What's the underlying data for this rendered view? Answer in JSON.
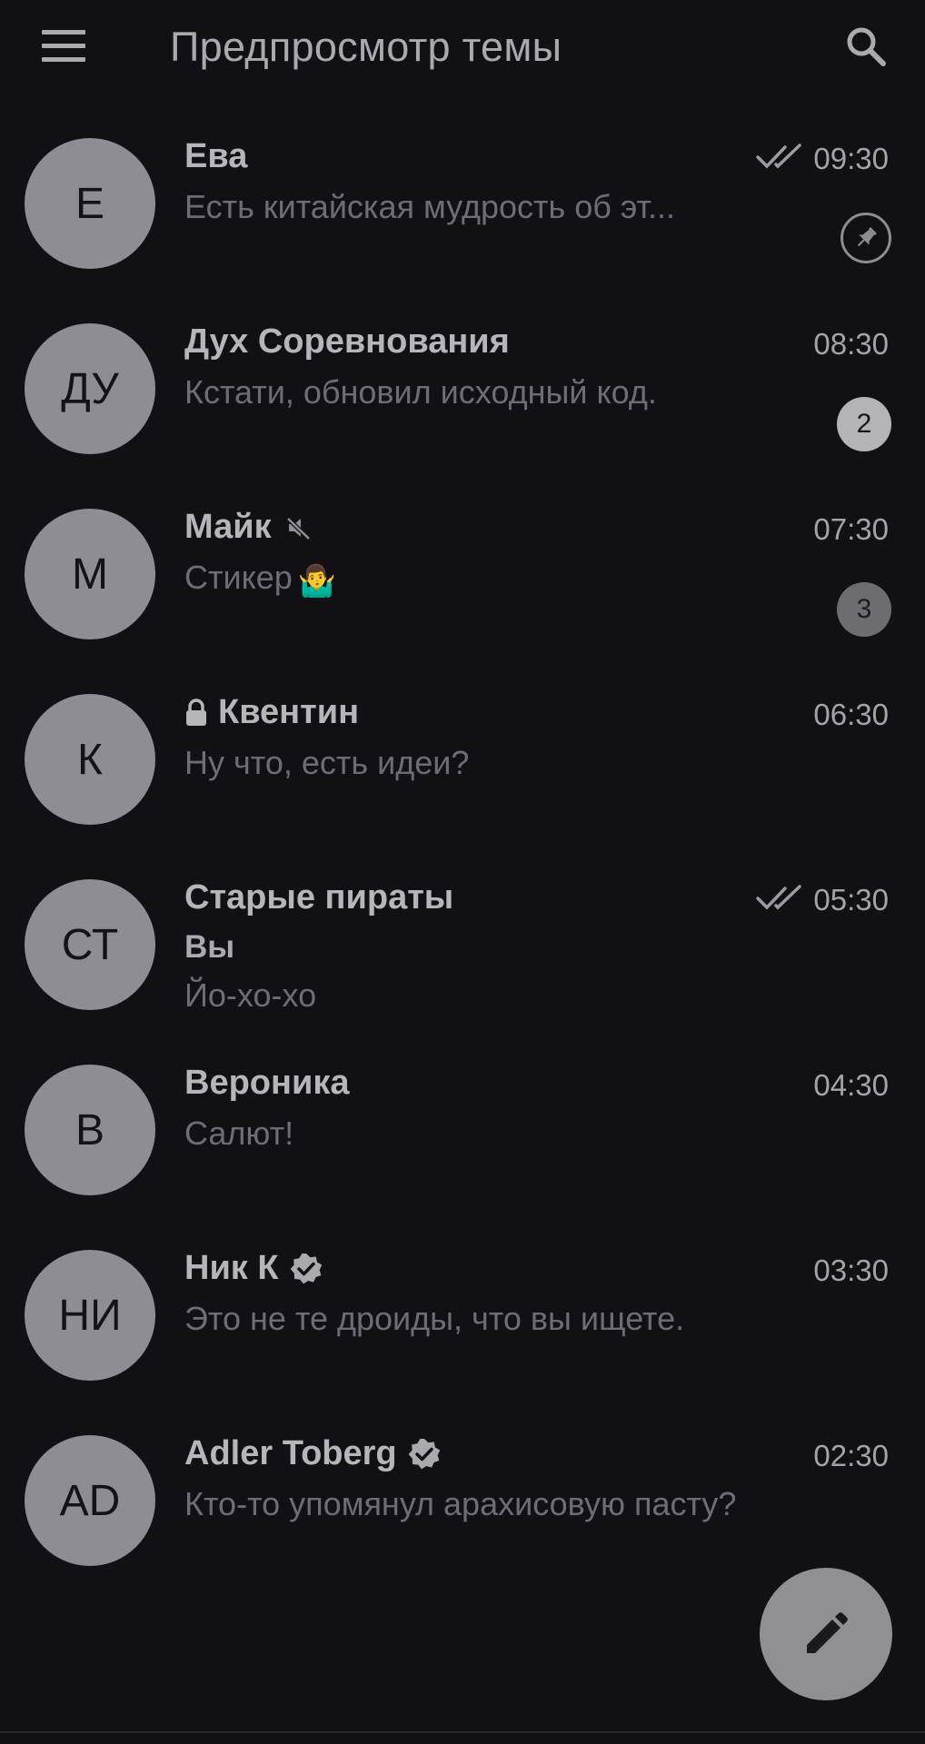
{
  "header": {
    "title": "Предпросмотр темы",
    "menu_icon": "menu-icon",
    "search_icon": "search-icon"
  },
  "chats": [
    {
      "initials": "Е",
      "name": "Ева",
      "time": "09:30",
      "preview": "Есть китайская мудрость об эт...",
      "read_checks": true,
      "pinned": true
    },
    {
      "initials": "ДУ",
      "name": "Дух Соревнования",
      "time": "08:30",
      "preview": "Кстати, обновил исходный код.",
      "unread": "2"
    },
    {
      "initials": "М",
      "name": "Майк",
      "time": "07:30",
      "preview": "Стикер",
      "preview_emoji": "🤷‍♂️",
      "muted": true,
      "unread": "3"
    },
    {
      "initials": "К",
      "name": "Квентин",
      "time": "06:30",
      "preview": "Ну что, есть идеи?",
      "secret": true
    },
    {
      "initials": "СТ",
      "name": "Старые пираты",
      "time": "05:30",
      "sender": "Вы",
      "preview": "Йо-хо-хо",
      "read_checks": true
    },
    {
      "initials": "В",
      "name": "Вероника",
      "time": "04:30",
      "preview": "Салют!"
    },
    {
      "initials": "НИ",
      "name": "Ник К",
      "time": "03:30",
      "preview": "Это не те дроиды, что вы ищете.",
      "verified": true
    },
    {
      "initials": "AD",
      "name": "Adler Toberg",
      "time": "02:30",
      "preview": "Кто-то упомянул арахисовую пасту?",
      "verified": true
    }
  ],
  "fab": {
    "icon": "pencil-icon"
  },
  "colors": {
    "background": "#111015",
    "avatar": "#8d8d93",
    "unread_badge": "#b3b3b8",
    "muted_badge": "#6c6c71"
  }
}
